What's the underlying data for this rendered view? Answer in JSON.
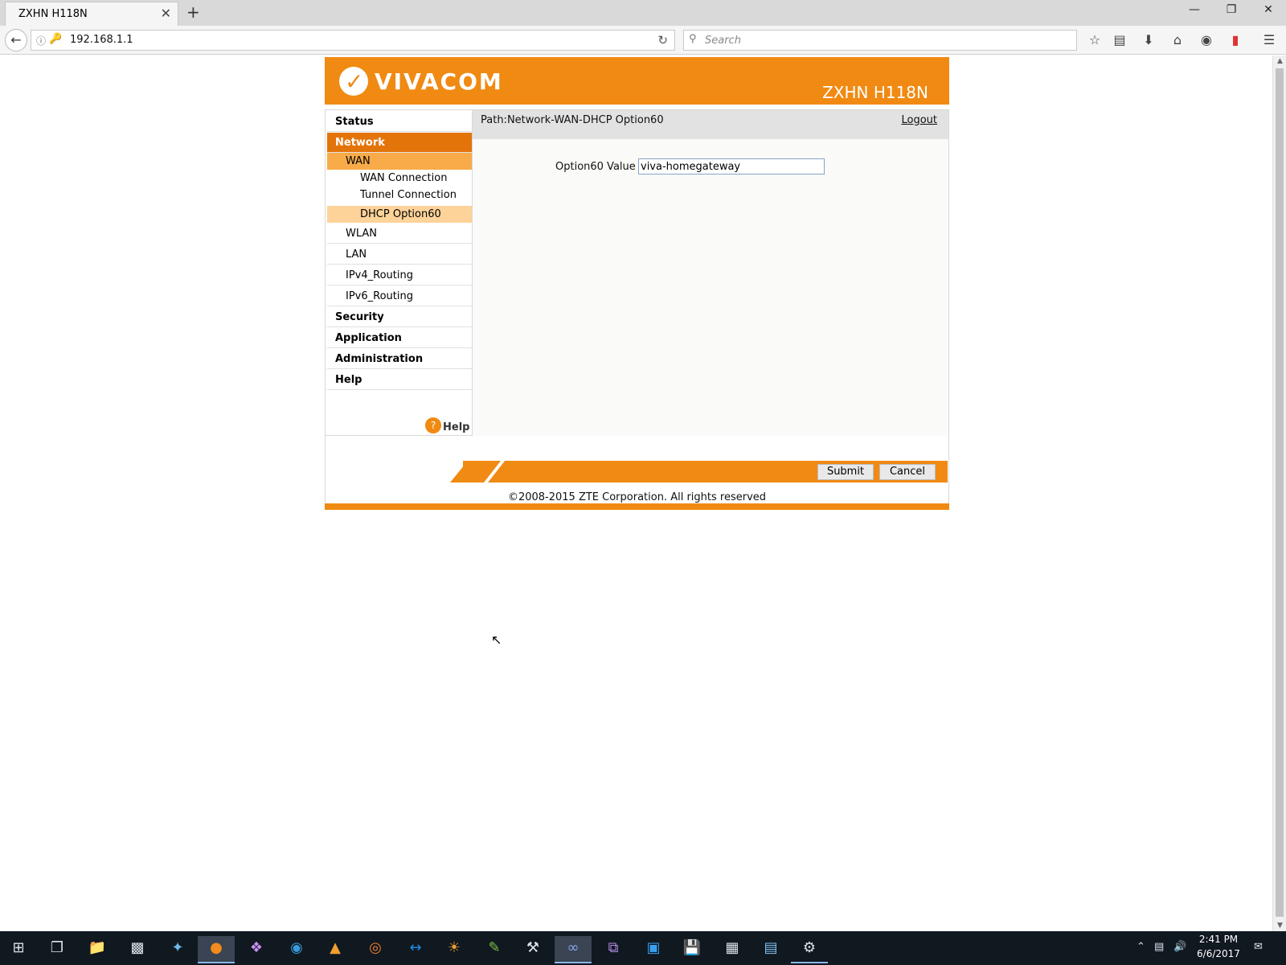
{
  "browser": {
    "tab_title": "ZXHN H118N",
    "tab_close": "✕",
    "new_tab": "+",
    "url": "192.168.1.1",
    "search_placeholder": "Search",
    "window_controls": [
      "—",
      "❐",
      "✕"
    ]
  },
  "router": {
    "brand": "VIVACOM",
    "model": "ZXHN H118N",
    "path": "Path:Network-WAN-DHCP Option60",
    "logout": "Logout",
    "menu": {
      "status": "Status",
      "network": "Network",
      "wan": "WAN",
      "wan_connection": "WAN Connection",
      "tunnel_connection": "Tunnel Connection",
      "dhcp_option60": "DHCP Option60",
      "wlan": "WLAN",
      "lan": "LAN",
      "ipv4_routing": "IPv4_Routing",
      "ipv6_routing": "IPv6_Routing",
      "security": "Security",
      "application": "Application",
      "administration": "Administration",
      "help": "Help"
    },
    "help_button": "Help",
    "form": {
      "option60_label": "Option60 Value",
      "option60_value": "viva-homegateway"
    },
    "submit": "Submit",
    "cancel": "Cancel",
    "copyright": "©2008-2015 ZTE Corporation. All rights reserved"
  },
  "taskbar": {
    "time": "2:41 PM",
    "date": "6/6/2017"
  },
  "colors": {
    "brand_orange": "#f08a13",
    "menu_active": "#e3740a"
  }
}
